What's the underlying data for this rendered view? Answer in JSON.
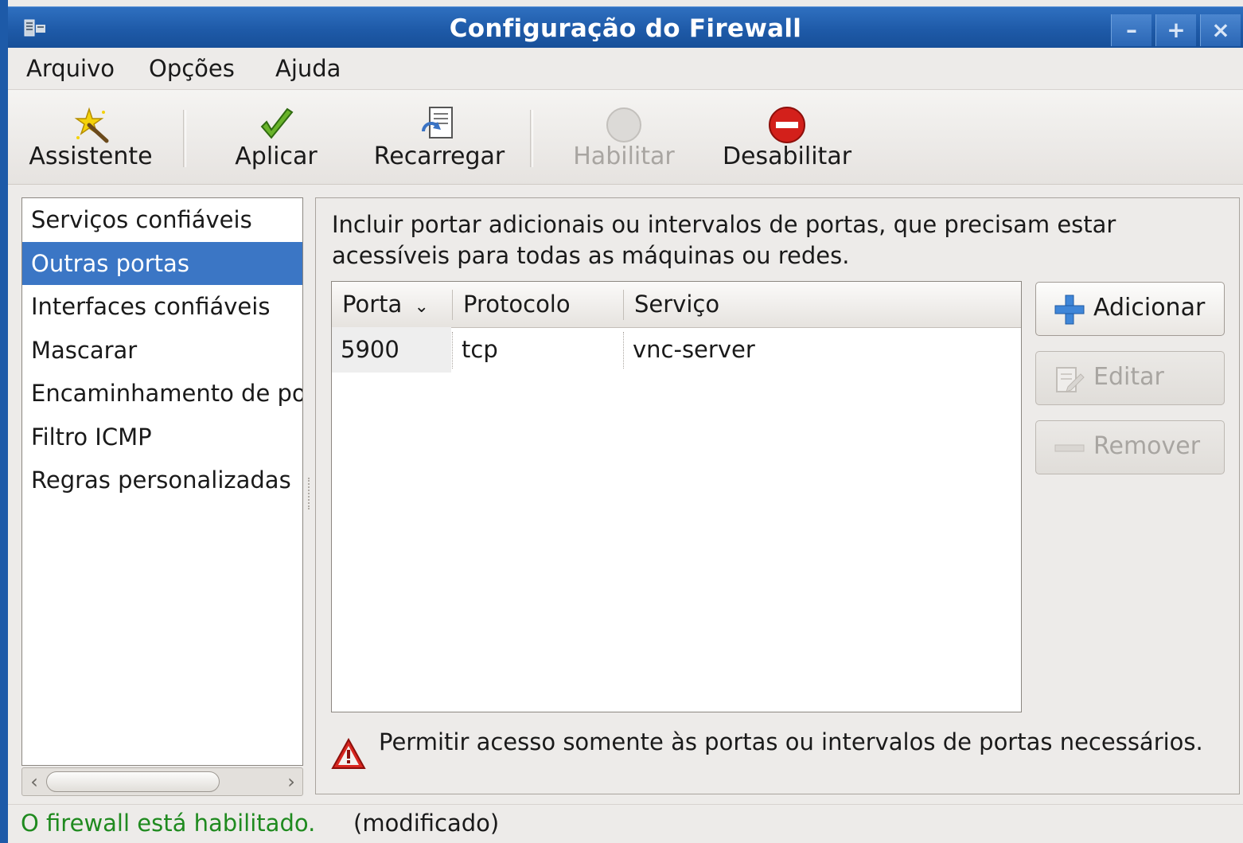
{
  "window": {
    "title": "Configuração do Firewall",
    "controls": [
      "–",
      "+",
      "×"
    ]
  },
  "menubar": {
    "items": [
      {
        "label": "Arquivo"
      },
      {
        "label": "Opções"
      },
      {
        "label": "Ajuda"
      }
    ]
  },
  "toolbar": {
    "assistente": "Assistente",
    "aplicar": "Aplicar",
    "recarregar": "Recarregar",
    "habilitar": "Habilitar",
    "desabilitar": "Desabilitar"
  },
  "sidebar": {
    "items": [
      {
        "label": "Serviços confiáveis"
      },
      {
        "label": "Outras portas"
      },
      {
        "label": "Interfaces confiáveis"
      },
      {
        "label": "Mascarar"
      },
      {
        "label": "Encaminhamento de portas"
      },
      {
        "label": "Filtro ICMP"
      },
      {
        "label": "Regras personalizadas"
      }
    ],
    "selected": "Outras portas"
  },
  "main": {
    "description": "Incluir portar adicionais ou intervalos de portas, que precisam estar acessíveis para todas as máquinas ou redes.",
    "table": {
      "columns": [
        "Porta",
        "Protocolo",
        "Serviço"
      ],
      "sort_indicator": "⌄",
      "rows": [
        {
          "porta": "5900",
          "protocolo": "tcp",
          "servico": "vnc-server"
        }
      ]
    },
    "buttons": {
      "adicionar": "Adicionar",
      "editar": "Editar",
      "remover": "Remover"
    },
    "warning": "Permitir acesso somente às portas ou intervalos de portas necessários."
  },
  "statusbar": {
    "state": "O firewall está habilitado.",
    "modified": "(modificado)"
  },
  "colors": {
    "selection": "#3b76c5",
    "titlebar": "#1e5aa8",
    "status_green": "#1f8a1f"
  }
}
